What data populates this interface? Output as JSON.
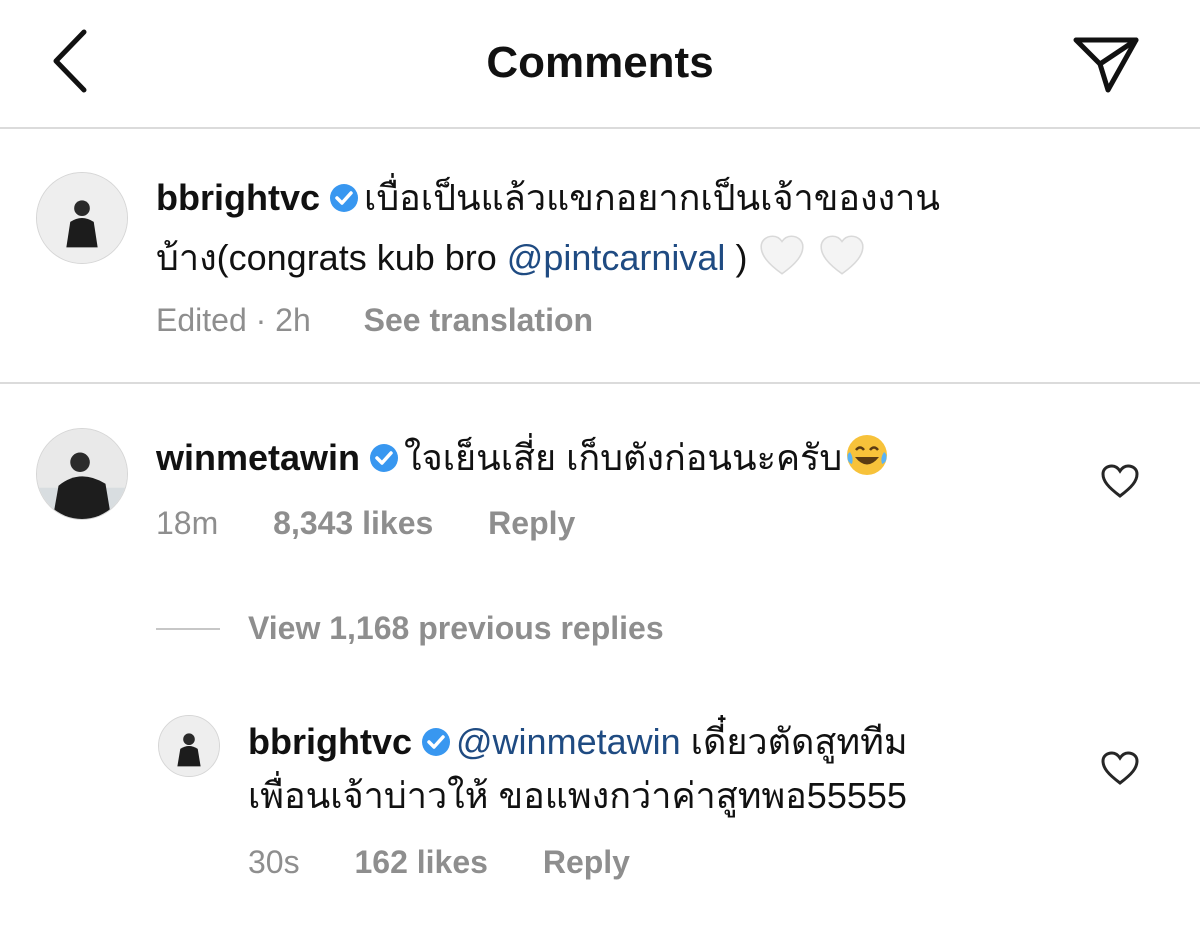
{
  "header": {
    "title": "Comments",
    "back_icon": "chevron-left-icon",
    "send_icon": "paper-plane-icon"
  },
  "caption": {
    "username": "bbrightvc",
    "text_line1": "เบื่อเป็นแล้วแขกอยากเป็นเจ้าของงาน",
    "text_line2_prefix": "บ้าง(congrats kub bro ",
    "mention": "@pintcarnival",
    "text_line2_suffix": " )",
    "emoji": "white-heart-icon",
    "edited": "Edited · 2h",
    "see_translation": "See translation"
  },
  "comment": {
    "username": "winmetawin",
    "text": "ใจเย็นเสี่ย เก็บตังก่อนนะครับ",
    "emoji": "tears-of-joy-icon",
    "time": "18m",
    "likes": "8,343 likes",
    "reply": "Reply"
  },
  "view_replies": "View 1,168 previous replies",
  "reply": {
    "username": "bbrightvc",
    "mention": "@winmetawin",
    "text_line1": " เดี๋ยวตัดสูททีม",
    "text_line2": "เพื่อนเจ้าบ่าวให้ ขอแพงกว่าค่าสูทพอ55555",
    "time": "30s",
    "likes": "162 likes",
    "reply": "Reply"
  },
  "colors": {
    "mention": "#1f4b82",
    "verified": "#3897f0",
    "meta": "#8e8e8e",
    "divider": "#dbdbdb"
  }
}
